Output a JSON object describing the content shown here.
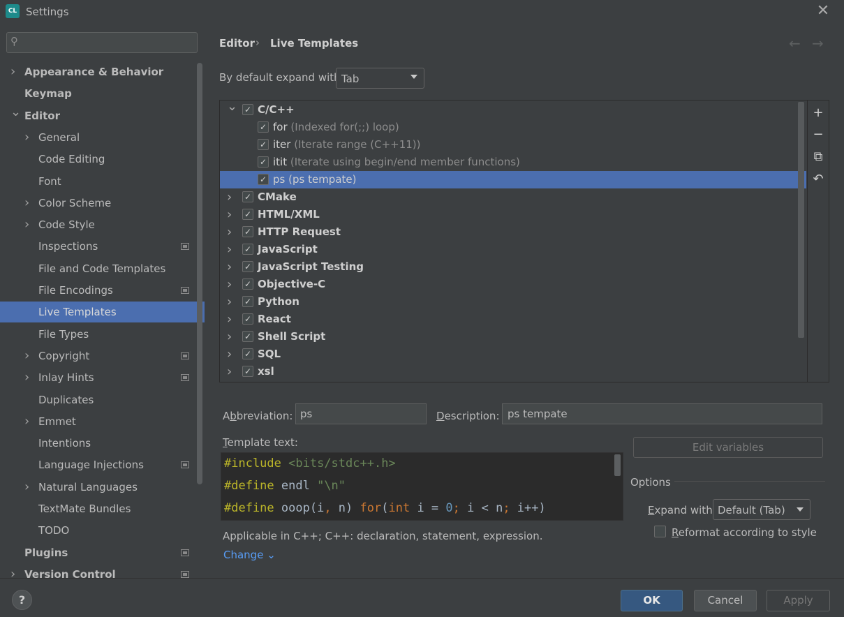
{
  "window": {
    "title": "Settings",
    "app_icon": "CL",
    "close_icon": "✕"
  },
  "sidebar": {
    "search_placeholder": "",
    "items": [
      {
        "label": "Appearance & Behavior",
        "level": 0,
        "expandable": true,
        "badge": false,
        "bold": true
      },
      {
        "label": "Keymap",
        "level": 0,
        "expandable": false,
        "badge": false,
        "bold": true
      },
      {
        "label": "Editor",
        "level": 0,
        "expandable": true,
        "expanded": true,
        "badge": false,
        "bold": true
      },
      {
        "label": "General",
        "level": 1,
        "expandable": true,
        "badge": false
      },
      {
        "label": "Code Editing",
        "level": 1,
        "expandable": false,
        "badge": false
      },
      {
        "label": "Font",
        "level": 1,
        "expandable": false,
        "badge": false
      },
      {
        "label": "Color Scheme",
        "level": 1,
        "expandable": true,
        "badge": false
      },
      {
        "label": "Code Style",
        "level": 1,
        "expandable": true,
        "badge": false
      },
      {
        "label": "Inspections",
        "level": 1,
        "expandable": false,
        "badge": true
      },
      {
        "label": "File and Code Templates",
        "level": 1,
        "expandable": false,
        "badge": false
      },
      {
        "label": "File Encodings",
        "level": 1,
        "expandable": false,
        "badge": true
      },
      {
        "label": "Live Templates",
        "level": 1,
        "expandable": false,
        "badge": false,
        "selected": true
      },
      {
        "label": "File Types",
        "level": 1,
        "expandable": false,
        "badge": false
      },
      {
        "label": "Copyright",
        "level": 1,
        "expandable": true,
        "badge": true
      },
      {
        "label": "Inlay Hints",
        "level": 1,
        "expandable": true,
        "badge": true
      },
      {
        "label": "Duplicates",
        "level": 1,
        "expandable": false,
        "badge": false
      },
      {
        "label": "Emmet",
        "level": 1,
        "expandable": true,
        "badge": false
      },
      {
        "label": "Intentions",
        "level": 1,
        "expandable": false,
        "badge": false
      },
      {
        "label": "Language Injections",
        "level": 1,
        "expandable": false,
        "badge": true
      },
      {
        "label": "Natural Languages",
        "level": 1,
        "expandable": true,
        "badge": false
      },
      {
        "label": "TextMate Bundles",
        "level": 1,
        "expandable": false,
        "badge": false
      },
      {
        "label": "TODO",
        "level": 1,
        "expandable": false,
        "badge": false
      },
      {
        "label": "Plugins",
        "level": 0,
        "expandable": false,
        "badge": true,
        "bold": true
      },
      {
        "label": "Version Control",
        "level": 0,
        "expandable": true,
        "badge": true,
        "bold": true
      }
    ]
  },
  "breadcrumb": {
    "parent": "Editor",
    "separator": "›",
    "current": "Live Templates",
    "back_icon": "←",
    "forward_icon": "→"
  },
  "expand_default": {
    "label": "By default expand with",
    "value": "Tab"
  },
  "templates": {
    "rows": [
      {
        "type": "group",
        "name": "C/C++",
        "expanded": true,
        "checked": true
      },
      {
        "type": "item",
        "name": "for",
        "desc": "(Indexed for(;;) loop)",
        "checked": true
      },
      {
        "type": "item",
        "name": "iter",
        "desc": "(Iterate range (C++11))",
        "checked": true
      },
      {
        "type": "item",
        "name": "itit",
        "desc": "(Iterate using begin/end member functions)",
        "checked": true
      },
      {
        "type": "item",
        "name": "ps",
        "desc": "(ps tempate)",
        "checked": true,
        "selected": true
      },
      {
        "type": "group",
        "name": "CMake",
        "checked": true
      },
      {
        "type": "group",
        "name": "HTML/XML",
        "checked": true
      },
      {
        "type": "group",
        "name": "HTTP Request",
        "checked": true
      },
      {
        "type": "group",
        "name": "JavaScript",
        "checked": true
      },
      {
        "type": "group",
        "name": "JavaScript Testing",
        "checked": true
      },
      {
        "type": "group",
        "name": "Objective-C",
        "checked": true
      },
      {
        "type": "group",
        "name": "Python",
        "checked": true
      },
      {
        "type": "group",
        "name": "React",
        "checked": true
      },
      {
        "type": "group",
        "name": "Shell Script",
        "checked": true
      },
      {
        "type": "group",
        "name": "SQL",
        "checked": true
      },
      {
        "type": "group",
        "name": "xsl",
        "checked": true
      }
    ],
    "tools": [
      {
        "name": "add-icon",
        "glyph": "+"
      },
      {
        "name": "remove-icon",
        "glyph": "−"
      },
      {
        "name": "copy-icon",
        "glyph": "⧉"
      },
      {
        "name": "restore-icon",
        "glyph": "↶"
      }
    ]
  },
  "editor": {
    "abbreviation_label": "Abbreviation:",
    "abbreviation_value": "ps",
    "description_label": "Description:",
    "description_value": "ps tempate",
    "template_text_label": "Template text:",
    "edit_variables": "Edit variables",
    "applicable": "Applicable in C++; C++: declaration, statement, expression.",
    "change_link": "Change ⌄"
  },
  "template_code": [
    [
      {
        "t": "#include",
        "c": "kw"
      },
      {
        "t": " ",
        "c": ""
      },
      {
        "t": "<bits/stdc++.h>",
        "c": "str"
      }
    ],
    [
      {
        "t": "#define",
        "c": "kw"
      },
      {
        "t": " endl ",
        "c": ""
      },
      {
        "t": "\"\\n\"",
        "c": "str"
      }
    ],
    [
      {
        "t": "#define",
        "c": "kw"
      },
      {
        "t": " ooop(i",
        "c": ""
      },
      {
        "t": ",",
        "c": "org"
      },
      {
        "t": " n) ",
        "c": ""
      },
      {
        "t": "for",
        "c": "org"
      },
      {
        "t": "(",
        "c": ""
      },
      {
        "t": "int",
        "c": "org"
      },
      {
        "t": " i = ",
        "c": ""
      },
      {
        "t": "0",
        "c": "num"
      },
      {
        "t": ";",
        "c": "org"
      },
      {
        "t": " i < n",
        "c": ""
      },
      {
        "t": ";",
        "c": "org"
      },
      {
        "t": " i++)",
        "c": ""
      }
    ]
  ],
  "options": {
    "title": "Options",
    "expand_with_label": "Expand with",
    "expand_with_value": "Default (Tab)",
    "reformat_label": "Reformat according to style",
    "reformat_checked": false
  },
  "footer": {
    "help": "?",
    "ok": "OK",
    "cancel": "Cancel",
    "apply": "Apply"
  }
}
